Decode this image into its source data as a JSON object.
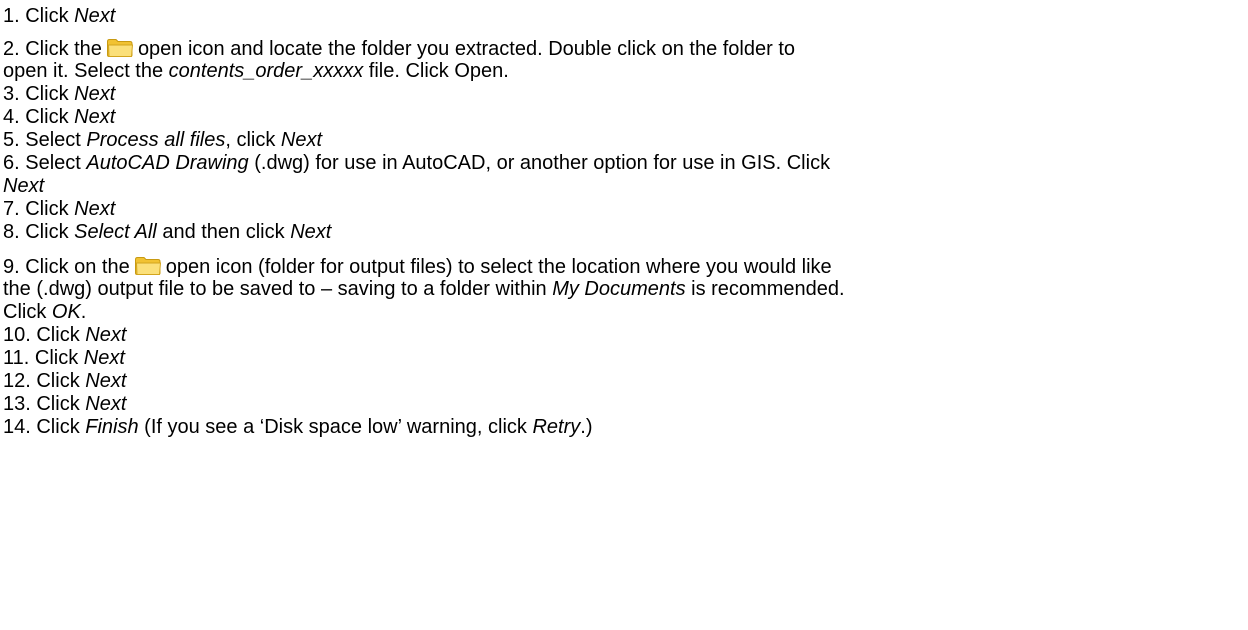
{
  "steps": {
    "s1": {
      "a": "1. Click ",
      "b": "Next"
    },
    "s2": {
      "a": "2. Click the",
      "b": "open icon and locate the folder you extracted. Double click on the folder to",
      "c": "open it. Select the ",
      "d": "contents_order_xxxxx",
      "e": " file. Click Open."
    },
    "s3": {
      "a": "3. Click ",
      "b": "Next"
    },
    "s4": {
      "a": "4. Click ",
      "b": "Next"
    },
    "s5": {
      "a": "5. Select ",
      "b": "Process all files",
      "c": ", click ",
      "d": "Next"
    },
    "s6": {
      "a": "6. Select ",
      "b": "AutoCAD Drawing",
      "c": " (.dwg) for use in AutoCAD, or another option for use in GIS. Click",
      "d": "Next"
    },
    "s7": {
      "a": "7. Click ",
      "b": "Next"
    },
    "s8": {
      "a": "8. Click ",
      "b": "Select All",
      "c": " and then click ",
      "d": "Next"
    },
    "s9": {
      "a": "9. Click on the",
      "b": "open icon (folder for output files) to select the location where you would like",
      "c": "the (.dwg) output file to be saved to – saving to a folder within ",
      "d": "My Documents",
      "e": " is recommended.",
      "f": "Click ",
      "g": "OK",
      "h": "."
    },
    "s10": {
      "a": "10. Click ",
      "b": "Next"
    },
    "s11": {
      "a": "11. Click ",
      "b": "Next"
    },
    "s12": {
      "a": "12. Click ",
      "b": "Next"
    },
    "s13": {
      "a": "13. Click ",
      "b": "Next"
    },
    "s14": {
      "a": "14. Click ",
      "b": "Finish",
      "c": " (If you see a ‘Disk space low’ warning, click ",
      "d": "Retry",
      "e": ".)"
    }
  },
  "icons": {
    "folder": "folder-open-icon",
    "folder_color": "#f7d24a"
  }
}
